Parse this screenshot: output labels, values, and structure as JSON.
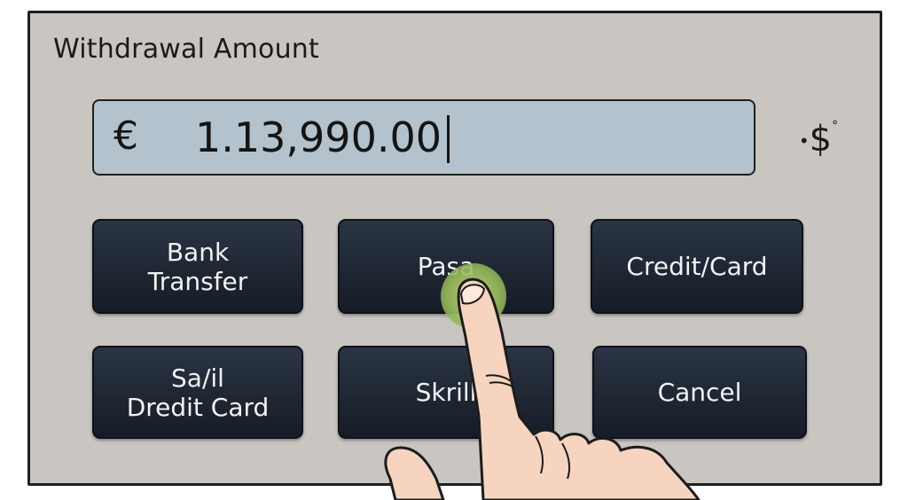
{
  "panel": {
    "title": "Withdrawal Amount"
  },
  "amount": {
    "currency_symbol": "€",
    "value": "1.13,990.00"
  },
  "side_icon": {
    "name": "dollar-coin-icon",
    "glyph": "$"
  },
  "buttons": [
    {
      "line1": "Bank",
      "line2": "Transfer"
    },
    {
      "line1": "Pasa",
      "line2": ""
    },
    {
      "line1": "Credit/Card",
      "line2": ""
    },
    {
      "line1": "Sa/il",
      "line2": "Dredit Card"
    },
    {
      "line1": "Skrill",
      "line2": ""
    },
    {
      "line1": "Cancel",
      "line2": ""
    }
  ],
  "colors": {
    "panel_bg": "#c9c5c1",
    "amount_field_bg": "#b3c2cc",
    "button_bg": "#1f2833",
    "touch_indicator": "#a9c46a",
    "skin": "#f6d4bf"
  }
}
